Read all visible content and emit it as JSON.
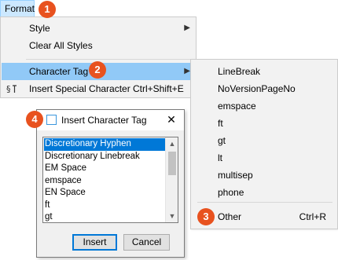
{
  "menubar": {
    "format_label": "Format"
  },
  "badges": [
    "1",
    "2",
    "3",
    "4"
  ],
  "format_menu": {
    "items": [
      {
        "label": "Style",
        "has_submenu": true
      },
      {
        "label": "Clear All Styles"
      },
      {
        "label": "Character Tag",
        "has_submenu": true,
        "highlighted": true
      },
      {
        "label": "Insert Special Character",
        "shortcut": "Ctrl+Shift+E",
        "icon": "special-character-icon"
      }
    ]
  },
  "character_tag_submenu": {
    "items": [
      "LineBreak",
      "NoVersionPageNo",
      "emspace",
      "ft",
      "gt",
      "lt",
      "multisep",
      "phone"
    ],
    "other": {
      "label": "Other",
      "shortcut": "Ctrl+R"
    }
  },
  "dialog": {
    "title": "Insert Character Tag",
    "list_items": [
      "Discretionary Hyphen",
      "Discretionary Linebreak",
      "EM Space",
      "emspace",
      "EN Space",
      "ft",
      "gt"
    ],
    "selected_index": 0,
    "insert_label": "Insert",
    "cancel_label": "Cancel"
  },
  "colors": {
    "badge": "#e8521f",
    "menu_highlight": "#91c9f7",
    "list_selection": "#0078d7"
  }
}
